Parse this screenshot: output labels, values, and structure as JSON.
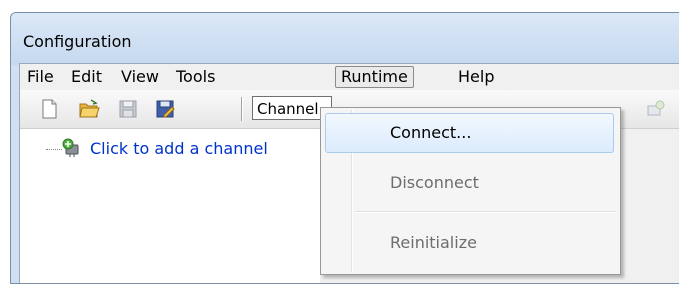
{
  "window": {
    "title": "Configuration"
  },
  "menubar": {
    "items": [
      "File",
      "Edit",
      "View",
      "Tools",
      "Runtime",
      "Help"
    ],
    "active": "Runtime"
  },
  "toolbar": {
    "icons": [
      "new-document-icon",
      "open-folder-icon",
      "save-icon",
      "save-as-icon"
    ],
    "combo_value": "Channel"
  },
  "tree": {
    "add_channel_label": "Click to add a channel"
  },
  "runtime_menu": {
    "items": [
      {
        "label": "Connect...",
        "enabled": true,
        "highlighted": true
      },
      {
        "label": "Disconnect",
        "enabled": false
      },
      {
        "label": "Reinitialize",
        "enabled": false
      }
    ]
  }
}
